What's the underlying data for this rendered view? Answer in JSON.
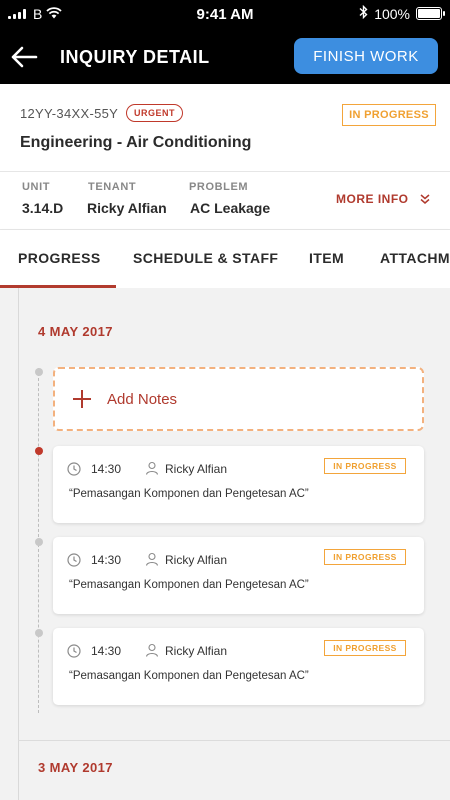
{
  "status_bar": {
    "carrier": "B",
    "time": "9:41 AM",
    "battery": "100%",
    "battery_level": 1.0,
    "icons": [
      "signal-icon",
      "wifi-icon",
      "bluetooth-icon",
      "battery-icon"
    ]
  },
  "nav": {
    "title": "INQUIRY DETAIL",
    "back_icon": "arrow-left-icon",
    "finish_label": "FINISH WORK"
  },
  "inquiry": {
    "id": "12YY-34XX-55Y",
    "priority": "URGENT",
    "status": "IN PROGRESS",
    "title": "Engineering - Air Conditioning",
    "meta": [
      {
        "label": "UNIT",
        "value": "3.14.D"
      },
      {
        "label": "TENANT",
        "value": "Ricky Alfian"
      },
      {
        "label": "PROBLEM",
        "value": "AC Leakage"
      }
    ],
    "more_info": "MORE INFO"
  },
  "tabs": [
    {
      "label": "PROGRESS",
      "active": true
    },
    {
      "label": "SCHEDULE & STAFF",
      "active": false
    },
    {
      "label": "ITEM",
      "active": false
    },
    {
      "label": "ATTACHMENT",
      "active": false
    }
  ],
  "progress": {
    "add_notes_label": "Add Notes",
    "groups": [
      {
        "date": "4 MAY 2017",
        "entries": [
          {
            "time": "14:30",
            "user": "Ricky Alfian",
            "status": "IN PROGRESS",
            "description": "“Pemasangan Komponen dan Pengetesan AC”"
          },
          {
            "time": "14:30",
            "user": "Ricky Alfian",
            "status": "IN PROGRESS",
            "description": "“Pemasangan Komponen dan Pengetesan AC”"
          },
          {
            "time": "14:30",
            "user": "Ricky Alfian",
            "status": "IN PROGRESS",
            "description": "“Pemasangan Komponen dan Pengetesan AC”"
          }
        ]
      },
      {
        "date": "3 MAY 2017",
        "entries": []
      }
    ]
  },
  "colors": {
    "accent_red": "#b03a2e",
    "button_blue": "#3d8ee0",
    "status_orange": "#f0a030"
  }
}
